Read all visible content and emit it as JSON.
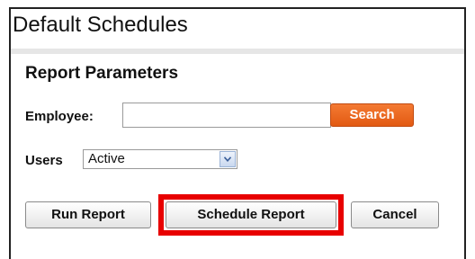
{
  "panel": {
    "title": "Default Schedules"
  },
  "form": {
    "section_title": "Report Parameters",
    "employee_label": "Employee:",
    "employee_value": "",
    "search_label": "Search",
    "users_label": "Users",
    "users_selected": "Active"
  },
  "actions": {
    "run_report_label": "Run Report",
    "schedule_report_label": "Schedule Report",
    "cancel_label": "Cancel"
  },
  "colors": {
    "search_button": "#e8661f",
    "highlight": "#e80000"
  },
  "icons": {
    "select_arrow": "chevron-down-icon"
  }
}
